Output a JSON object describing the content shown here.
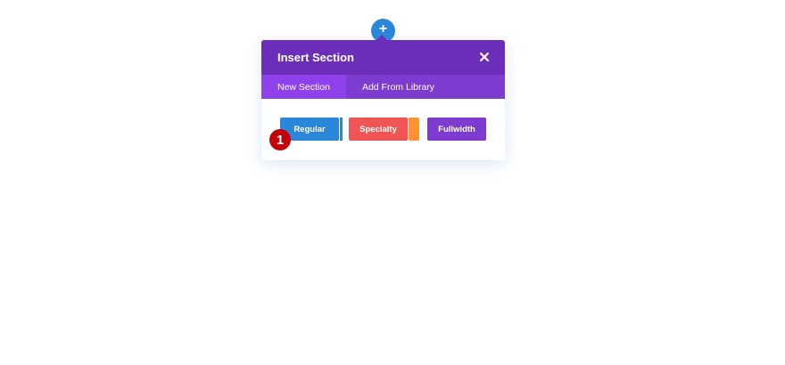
{
  "add_button": {
    "icon": "plus-icon",
    "glyph": "+"
  },
  "modal": {
    "title": "Insert Section",
    "close_icon": "close-icon",
    "tabs": [
      {
        "label": "New Section",
        "active": true
      },
      {
        "label": "Add From Library",
        "active": false
      }
    ],
    "section_types": [
      {
        "label": "Regular",
        "color": "#2b87da"
      },
      {
        "label": "Specialty",
        "color": "#ef5555",
        "accent_color": "#ff9232"
      },
      {
        "label": "Fullwidth",
        "color": "#7d3bcf"
      }
    ]
  },
  "step_badge": {
    "number": "1",
    "color": "#c2000b"
  },
  "colors": {
    "header": "#6c2eb9",
    "tab_bar": "#7e3bd0",
    "tab_active": "#8f42ec"
  }
}
